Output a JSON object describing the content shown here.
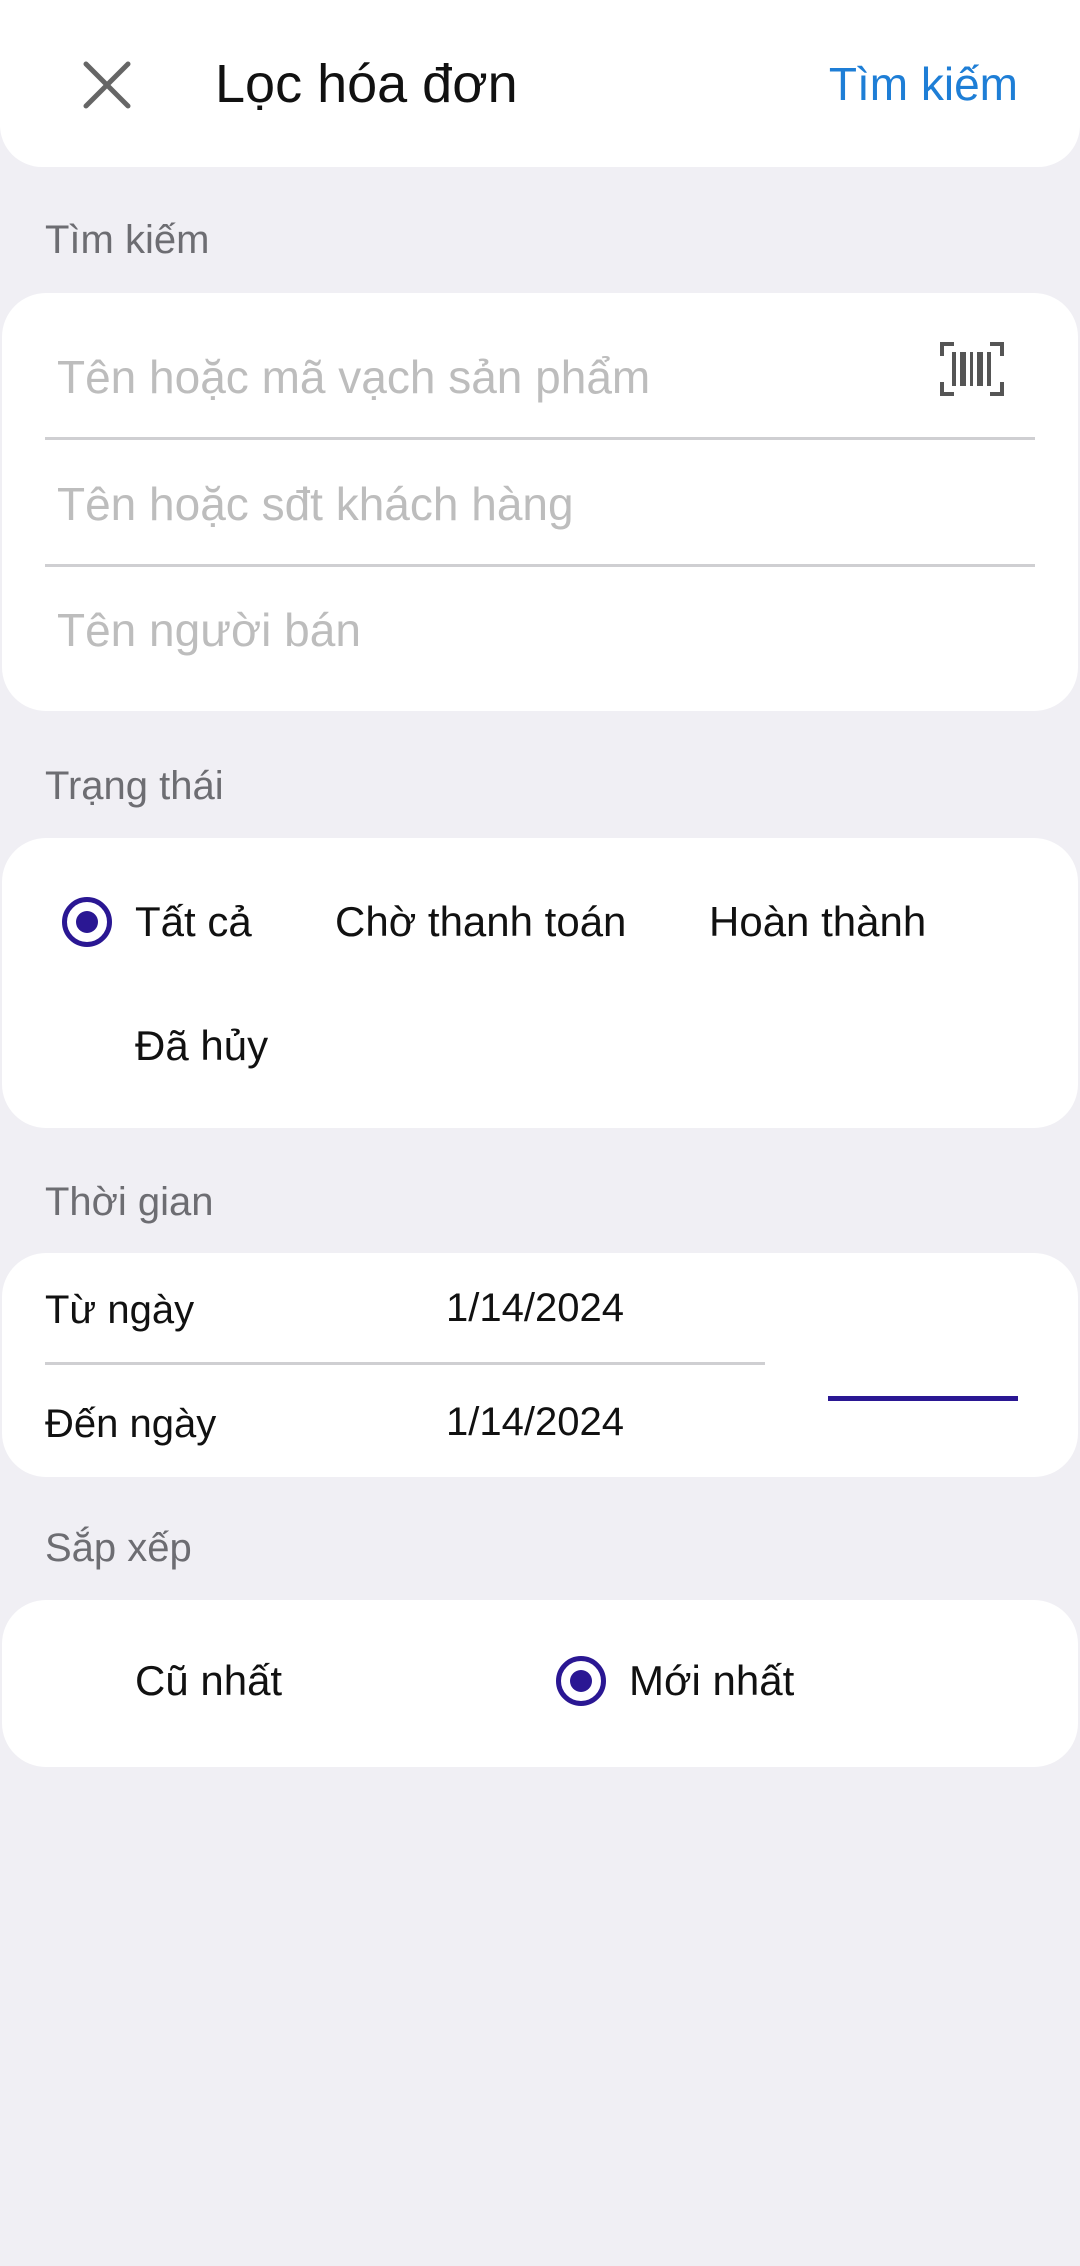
{
  "header": {
    "title": "Lọc hóa đơn",
    "search_label": "Tìm kiếm",
    "close_icon": "close-icon"
  },
  "search_section": {
    "label": "Tìm kiếm",
    "product_placeholder": "Tên hoặc mã vạch sản phẩm",
    "customer_placeholder": "Tên hoặc sđt khách hàng",
    "seller_placeholder": "Tên người bán",
    "barcode_icon": "barcode-scan-icon"
  },
  "status_section": {
    "label": "Trạng thái",
    "options": [
      {
        "label": "Tất cả",
        "selected": true
      },
      {
        "label": "Chờ thanh toán",
        "selected": false
      },
      {
        "label": "Hoàn thành",
        "selected": false
      },
      {
        "label": "Đã hủy",
        "selected": false
      }
    ]
  },
  "time_section": {
    "label": "Thời gian",
    "from_label": "Từ ngày",
    "from_value": "1/14/2024",
    "to_label": "Đến ngày",
    "to_value": "1/14/2024"
  },
  "sort_section": {
    "label": "Sắp xếp",
    "options": [
      {
        "label": "Cũ nhất",
        "selected": false
      },
      {
        "label": "Mới nhất",
        "selected": true
      }
    ]
  },
  "colors": {
    "accent": "#2a1793",
    "link": "#1e7ed6",
    "background": "#f0eff4"
  }
}
